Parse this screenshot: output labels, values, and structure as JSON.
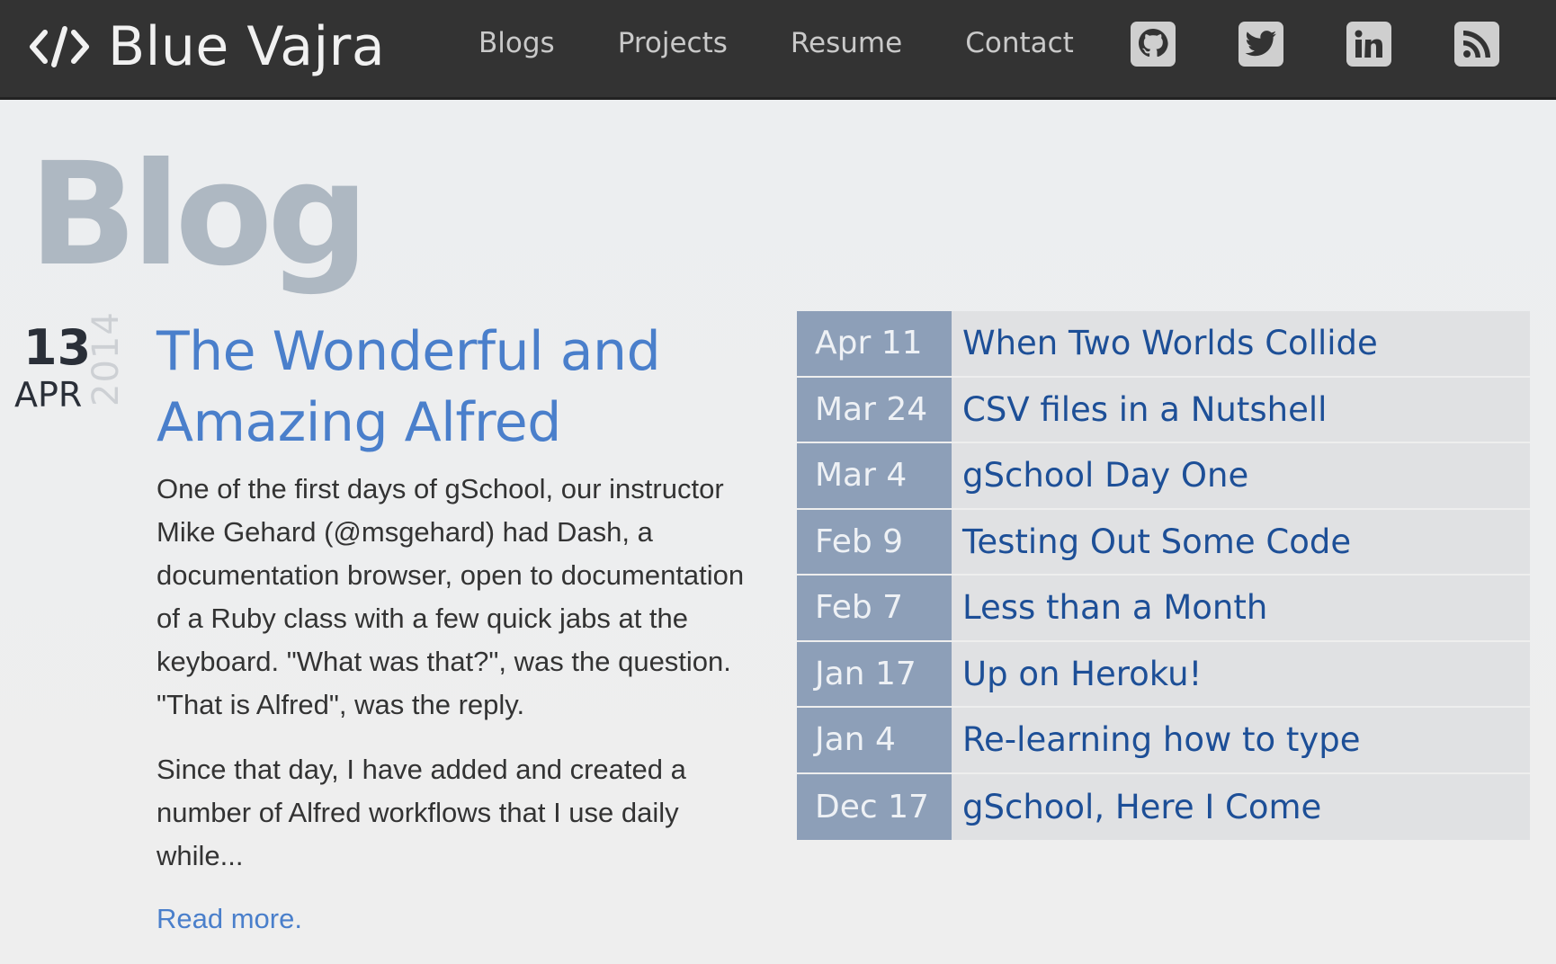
{
  "site": {
    "brand": "Blue Vajra",
    "nav": [
      {
        "label": "Blogs"
      },
      {
        "label": "Projects"
      },
      {
        "label": "Resume"
      },
      {
        "label": "Contact"
      }
    ],
    "socials": [
      "github-icon",
      "twitter-icon",
      "linkedin-icon",
      "rss-icon"
    ]
  },
  "page": {
    "title": "Blog"
  },
  "post": {
    "day": "13",
    "month": "APR",
    "year": "2014",
    "title": "The Wonderful and Amazing Alfred",
    "paragraphs": [
      "One of the first days of gSchool, our instructor Mike Gehard (@msgehard) had Dash, a documentation browser, open to documentation of a Ruby class with a few quick jabs at the keyboard. \"What was that?\", was the question. \"That is Alfred\", was the reply.",
      "Since that day, I have added and created a number of Alfred workflows that I use daily while..."
    ],
    "read_more": "Read more."
  },
  "archive": [
    {
      "date": "Apr 11",
      "title": "When Two Worlds Collide"
    },
    {
      "date": "Mar 24",
      "title": "CSV files in a Nutshell"
    },
    {
      "date": "Mar 4",
      "title": "gSchool Day One"
    },
    {
      "date": "Feb 9",
      "title": "Testing Out Some Code"
    },
    {
      "date": "Feb 7",
      "title": "Less than a Month"
    },
    {
      "date": "Jan 17",
      "title": "Up on Heroku!"
    },
    {
      "date": "Jan 4",
      "title": "Re-learning how to type"
    },
    {
      "date": "Dec 17",
      "title": "gSchool, Here I Come"
    }
  ],
  "colors": {
    "navbar": "#333333",
    "link": "#4a7fcb",
    "archive_date_bg": "#8d9fb8",
    "archive_link": "#1d4f97"
  }
}
